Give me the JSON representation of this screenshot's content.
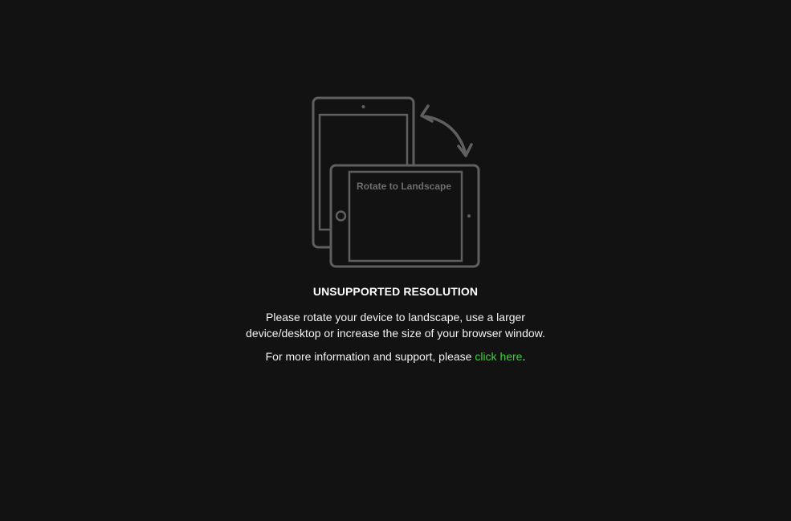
{
  "illustration": {
    "label": "Rotate to Landscape",
    "stroke_color": "#5f5f5f",
    "icons": [
      "portrait-tablet-icon",
      "landscape-tablet-icon",
      "rotate-arrow-icon"
    ]
  },
  "notice": {
    "heading": "UNSUPPORTED RESOLUTION",
    "message_line1": "Please rotate your device to landscape, use a larger",
    "message_line2": "device/desktop or increase the size of your browser window.",
    "support_prefix": "For more information and support, please ",
    "support_link": "click here",
    "support_suffix": "."
  },
  "colors": {
    "background": "#121212",
    "text": "#ffffff",
    "link": "#3fd13f"
  }
}
